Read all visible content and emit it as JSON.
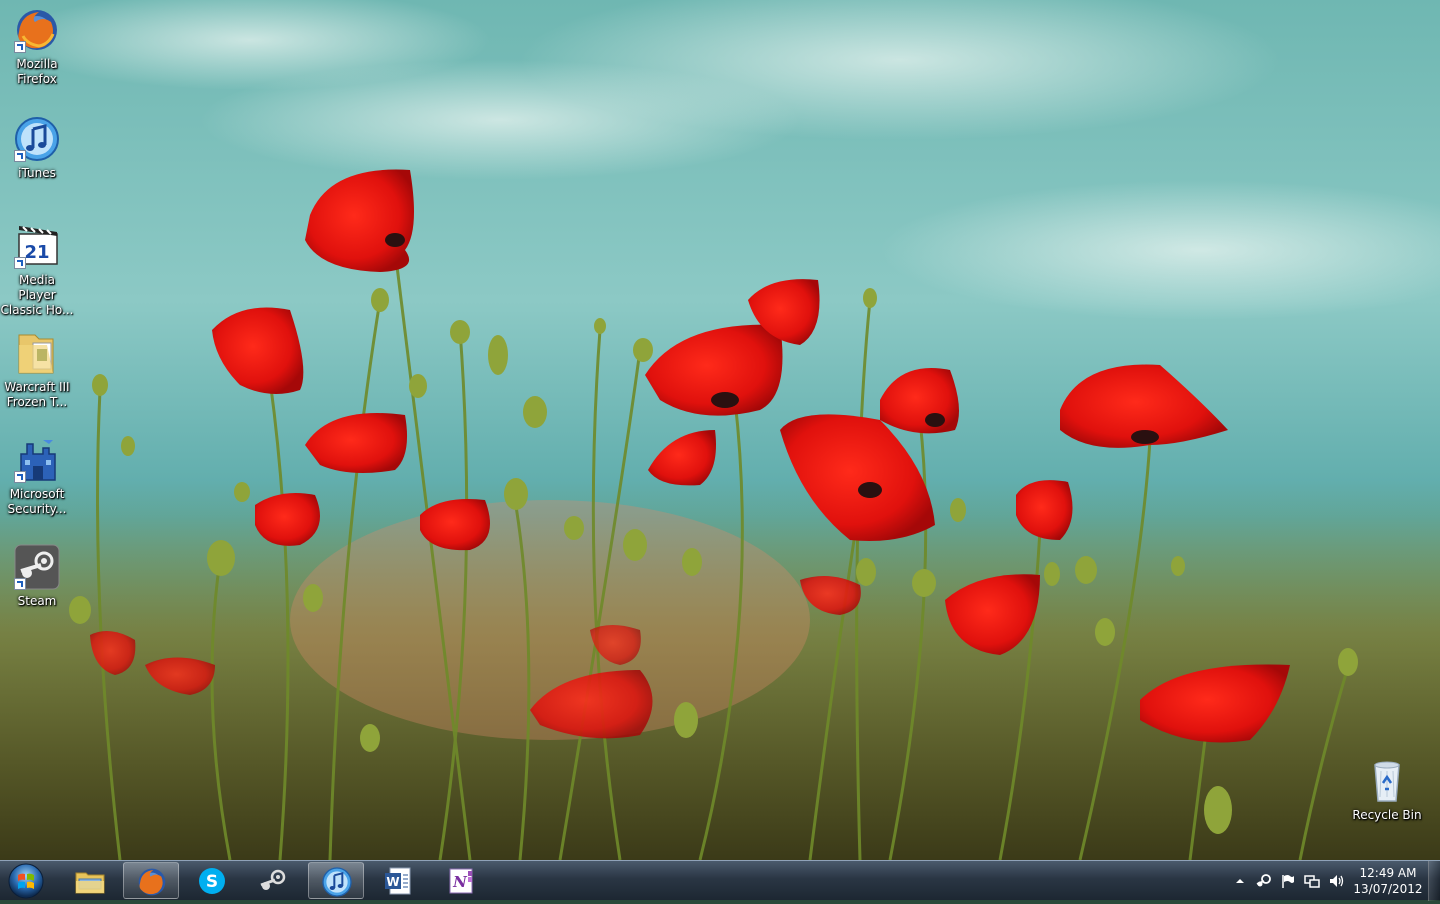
{
  "desktop": {
    "icons": [
      {
        "label": "Mozilla Firefox",
        "icon": "firefox-icon"
      },
      {
        "label": "iTunes",
        "icon": "itunes-icon"
      },
      {
        "label": "Media Player Classic Ho...",
        "icon": "media-player-classic-icon"
      },
      {
        "label": "Warcraft III Frozen T...",
        "icon": "warcraft-folder-icon"
      },
      {
        "label": "Microsoft Security...",
        "icon": "microsoft-security-icon"
      },
      {
        "label": "Steam",
        "icon": "steam-icon"
      }
    ],
    "recycle_bin": {
      "label": "Recycle Bin",
      "icon": "recycle-bin-icon"
    }
  },
  "taskbar": {
    "apps": [
      {
        "name": "windows-explorer",
        "icon": "folder-icon",
        "active": false
      },
      {
        "name": "firefox",
        "icon": "firefox-icon",
        "active": true
      },
      {
        "name": "skype",
        "icon": "skype-icon",
        "active": false
      },
      {
        "name": "steam",
        "icon": "steam-icon",
        "active": false
      },
      {
        "name": "itunes",
        "icon": "itunes-icon",
        "active": true
      },
      {
        "name": "word",
        "icon": "word-icon",
        "active": false
      },
      {
        "name": "onenote",
        "icon": "onenote-icon",
        "active": false
      }
    ],
    "tray_icons": [
      "chevron-up-icon",
      "steam-tray-icon",
      "action-center-flag-icon",
      "network-icon",
      "volume-icon"
    ],
    "clock": {
      "time": "12:49 AM",
      "date": "13/07/2012"
    }
  }
}
